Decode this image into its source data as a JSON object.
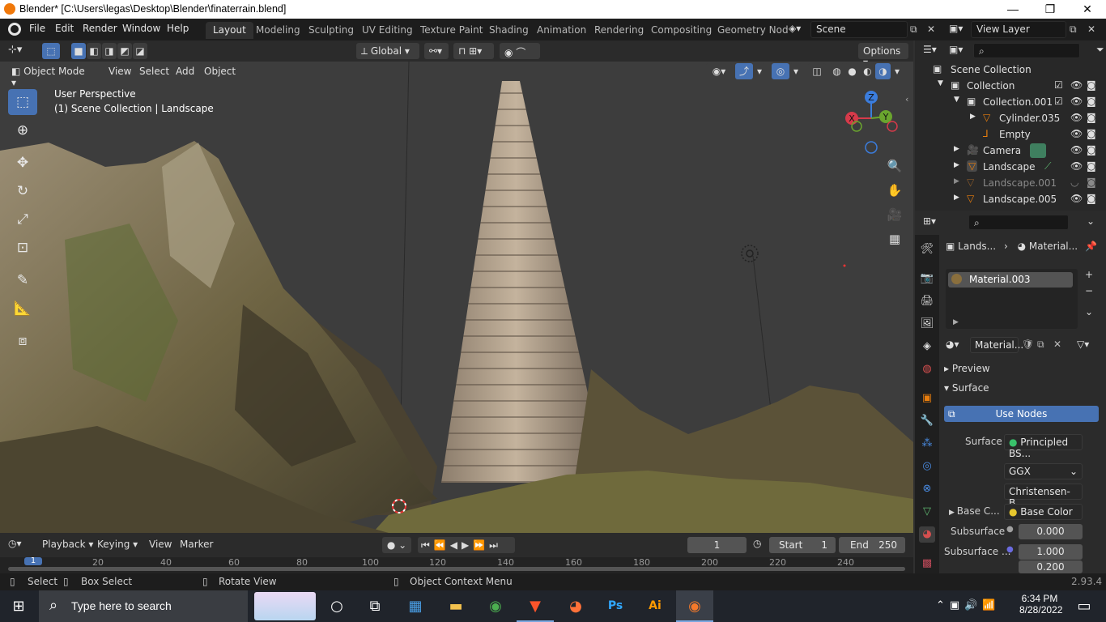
{
  "window": {
    "title": "Blender* [C:\\Users\\legas\\Desktop\\Blender\\finaterrain.blend]",
    "minimize": "—",
    "maximize": "❐",
    "close": "✕"
  },
  "menu": [
    "File",
    "Edit",
    "Render",
    "Window",
    "Help"
  ],
  "workspaces": [
    "Layout",
    "Modeling",
    "Sculpting",
    "UV Editing",
    "Texture Paint",
    "Shading",
    "Animation",
    "Rendering",
    "Compositing",
    "Geometry Nod"
  ],
  "active_workspace": "Layout",
  "scene": {
    "name": "Scene"
  },
  "view_layer": {
    "name": "View Layer"
  },
  "toolbar_header": {
    "orientation": "Global",
    "options": "Options"
  },
  "viewport_header": {
    "mode": "Object Mode",
    "menus": [
      "View",
      "Select",
      "Add",
      "Object"
    ]
  },
  "viewport": {
    "perspective": "User Perspective",
    "context": "(1) Scene Collection | Landscape"
  },
  "gizmo": {
    "x": "X",
    "y": "Y",
    "z": "Z"
  },
  "outliner": {
    "items": [
      {
        "label": "Scene Collection"
      },
      {
        "label": "Collection"
      },
      {
        "label": "Collection.001"
      },
      {
        "label": "Cylinder.035"
      },
      {
        "label": "Empty"
      },
      {
        "label": "Camera"
      },
      {
        "label": "Landscape"
      },
      {
        "label": "Landscape.001"
      },
      {
        "label": "Landscape.005"
      }
    ]
  },
  "properties": {
    "breadcrumb_object": "Lands...",
    "breadcrumb_material": "Material...",
    "material_slot": "Material.003",
    "material_name": "Material...",
    "panels": {
      "preview": "Preview",
      "surface": "Surface"
    },
    "use_nodes": "Use Nodes",
    "surface_label": "Surface",
    "surface_value": "Principled BS...",
    "distribution": "GGX",
    "subsurface_method": "Christensen-B...",
    "base_color_label": "Base C...",
    "base_color_value": "Base Color",
    "subsurface_label": "Subsurface",
    "subsurface_value": "0.000",
    "subsurface_radius_label": "Subsurface ...",
    "subsurface_radius_1": "1.000",
    "subsurface_radius_2": "0.200"
  },
  "timeline": {
    "menus": [
      "Playback",
      "Keying",
      "View",
      "Marker"
    ],
    "current_frame": "1",
    "start_label": "Start",
    "start_value": "1",
    "end_label": "End",
    "end_value": "250",
    "ruler": [
      "1",
      "20",
      "40",
      "60",
      "80",
      "100",
      "120",
      "140",
      "160",
      "180",
      "200",
      "220",
      "240"
    ]
  },
  "statusbar": {
    "select": "Select",
    "box_select": "Box Select",
    "rotate": "Rotate View",
    "context_menu": "Object Context Menu",
    "version": "2.93.4"
  },
  "taskbar": {
    "search_placeholder": "Type here to search",
    "time": "6:34 PM",
    "date": "8/28/2022"
  },
  "colors": {
    "accent": "#4772b3",
    "active_tab": "#303030",
    "orange": "#e87d0d"
  }
}
